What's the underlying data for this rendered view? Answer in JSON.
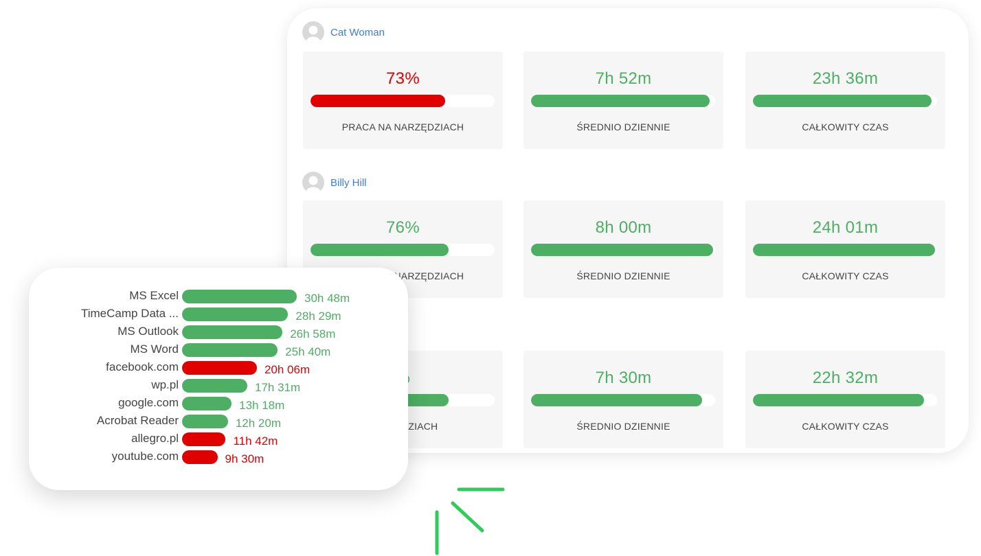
{
  "users": [
    {
      "name": "Cat Woman",
      "stats": [
        {
          "value": "73%",
          "fill": 0.73,
          "status": "red",
          "label": "PRACA NA NARZĘDZIACH"
        },
        {
          "value": "7h 52m",
          "fill": 0.97,
          "status": "green",
          "label": "ŚREDNIO DZIENNIE"
        },
        {
          "value": "23h 36m",
          "fill": 0.97,
          "status": "green",
          "label": "CAŁKOWITY CZAS"
        }
      ]
    },
    {
      "name": "Billy Hill",
      "stats": [
        {
          "value": "76%",
          "fill": 0.75,
          "status": "green",
          "label": "PRACA NA NARZĘDZIACH"
        },
        {
          "value": "8h 00m",
          "fill": 0.99,
          "status": "green",
          "label": "ŚREDNIO DZIENNIE"
        },
        {
          "value": "24h 01m",
          "fill": 0.99,
          "status": "green",
          "label": "CAŁKOWITY CZAS"
        }
      ]
    },
    {
      "name": "",
      "stats": [
        {
          "value": "%",
          "fill": 0.75,
          "status": "green",
          "label": "NARZĘDZIACH"
        },
        {
          "value": "7h 30m",
          "fill": 0.93,
          "status": "green",
          "label": "ŚREDNIO DZIENNIE"
        },
        {
          "value": "22h 32m",
          "fill": 0.93,
          "status": "green",
          "label": "CAŁKOWITY CZAS"
        }
      ]
    }
  ],
  "apps": [
    {
      "name": "MS Excel",
      "time": "30h 48m",
      "hours": 30.8,
      "status": "green"
    },
    {
      "name": "TimeCamp Data ...",
      "time": "28h 29m",
      "hours": 28.48,
      "status": "green"
    },
    {
      "name": "MS Outlook",
      "time": "26h 58m",
      "hours": 26.97,
      "status": "green"
    },
    {
      "name": "MS Word",
      "time": "25h 40m",
      "hours": 25.67,
      "status": "green"
    },
    {
      "name": "facebook.com",
      "time": "20h 06m",
      "hours": 20.1,
      "status": "red"
    },
    {
      "name": "wp.pl",
      "time": "17h 31m",
      "hours": 17.52,
      "status": "green"
    },
    {
      "name": "google.com",
      "time": "13h 18m",
      "hours": 13.3,
      "status": "green"
    },
    {
      "name": "Acrobat Reader",
      "time": "12h 20m",
      "hours": 12.33,
      "status": "green"
    },
    {
      "name": "allegro.pl",
      "time": "11h 42m",
      "hours": 11.7,
      "status": "red"
    },
    {
      "name": "youtube.com",
      "time": "9h 30m",
      "hours": 9.5,
      "status": "red"
    }
  ],
  "colors": {
    "green": "#4caf63",
    "red": "#e00000",
    "link": "#3b7dd8",
    "accent": "#2ecc5a"
  },
  "icons": {
    "avatar": "user-avatar-icon",
    "decoration": "spark-lines-decoration"
  }
}
